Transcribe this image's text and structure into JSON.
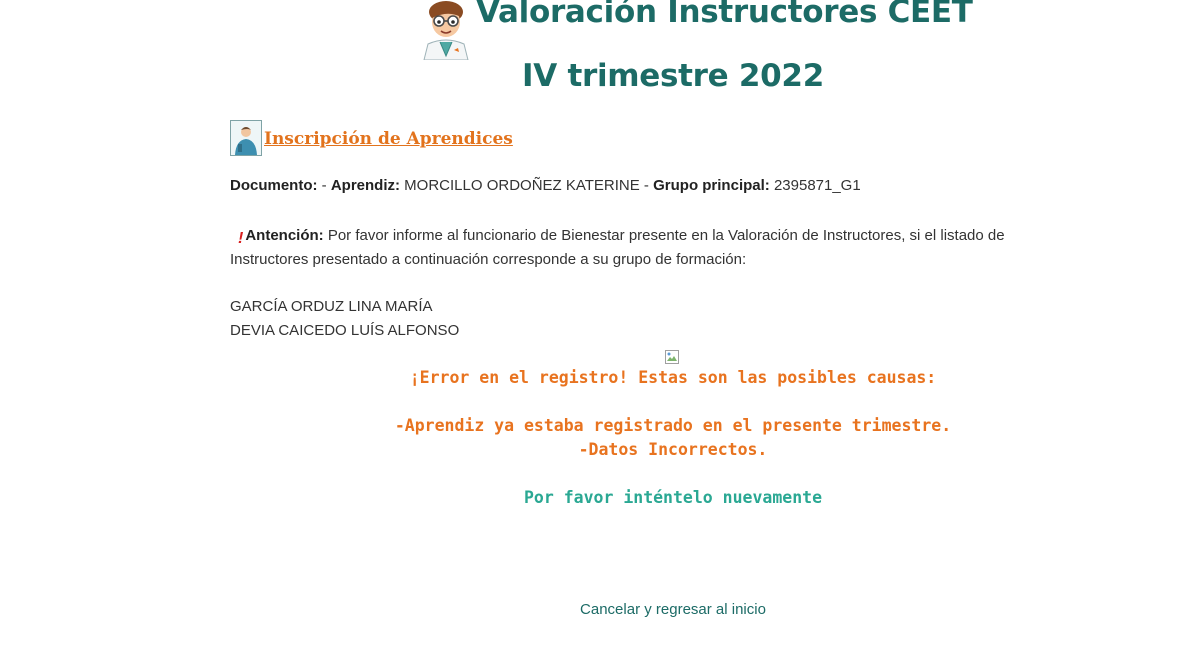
{
  "header": {
    "title": "Valoración Instructores CEET",
    "subtitle": "IV trimestre 2022"
  },
  "registration": {
    "link_label": "Inscripción de Aprendices"
  },
  "student": {
    "documento_label": "Documento:",
    "documento_value": " - ",
    "aprendiz_label": "Aprendiz:",
    "aprendiz_value": " MORCILLO ORDOÑEZ KATERINE - ",
    "grupo_label": "Grupo principal:",
    "grupo_value": " 2395871_G1"
  },
  "attention": {
    "icon": "exclamation-icon",
    "label": "Antención:",
    "text": " Por favor informe al funcionario de Bienestar presente en la Valoración de Instructores, si el listado de Instructores presentado a continuación corresponde a su grupo de formación:"
  },
  "instructors": [
    "GARCÍA ORDUZ LINA MARÍA",
    "DEVIA CAICEDO LUÍS ALFONSO"
  ],
  "error": {
    "heading": "¡Error en el registro! Estas son las posibles causas:",
    "cause_1": "-Aprendiz ya estaba registrado en el presente trimestre.",
    "cause_2": "-Datos Incorrectos.",
    "retry": "Por favor inténtelo nuevamente"
  },
  "actions": {
    "cancel_label": "Cancelar y regresar al inicio"
  },
  "colors": {
    "title": "#1c6b66",
    "accent_orange": "#e8731f",
    "accent_teal": "#2aa893",
    "alert_red": "#d81e1e"
  }
}
